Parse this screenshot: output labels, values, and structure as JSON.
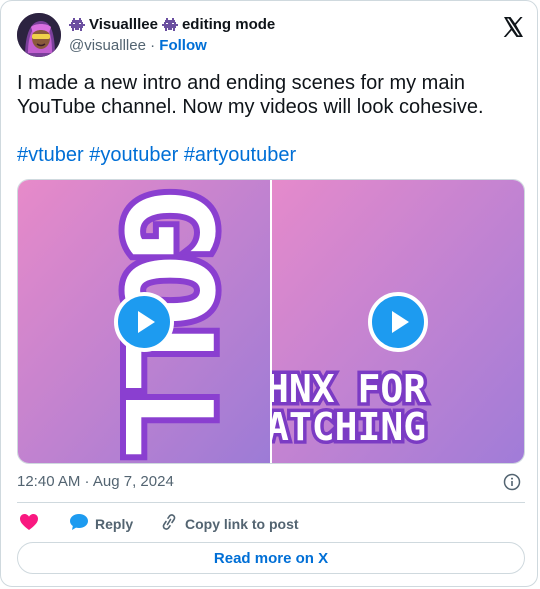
{
  "author": {
    "display_name": "Visualllee",
    "mode_label": "editing mode",
    "handle": "@visualllee",
    "follow_label": "Follow"
  },
  "tweet": {
    "text_line1": "I made a new intro and ending scenes for my main",
    "text_line2": "YouTube channel. Now my videos will look cohesive.",
    "hashtags": [
      "#vtuber",
      "#youtuber",
      "#artyoutuber"
    ],
    "media_left_text": "GOLL",
    "media_right_line1": "HNX FOR",
    "media_right_line2": "ATCHING",
    "timestamp": "12:40 AM · Aug 7, 2024"
  },
  "actions": {
    "reply_label": "Reply",
    "copy_label": "Copy link to post",
    "read_more_label": "Read more on X"
  },
  "colors": {
    "link": "#006fd6",
    "like": "#f91880",
    "reply": "#1d9bf0",
    "play": "#1d9bf0",
    "media_gradient_start": "#e78ac9",
    "media_gradient_end": "#9c7bd6"
  }
}
